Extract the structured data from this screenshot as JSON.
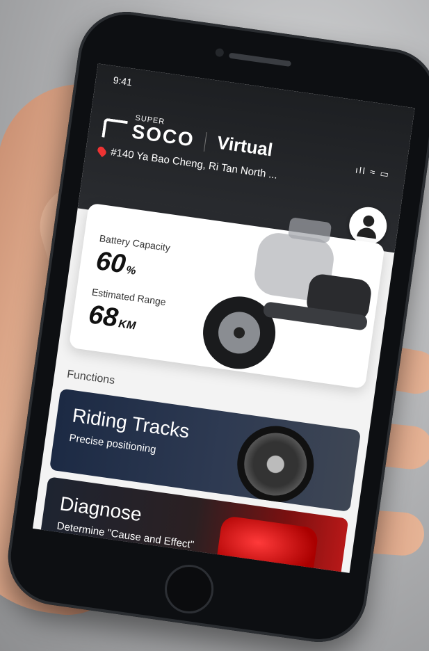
{
  "status_bar": {
    "time": "9:41",
    "icons": "ıll ≈ ▭"
  },
  "brand": {
    "super": "SUPER",
    "soco": "SOCO",
    "mode": "Virtual"
  },
  "location": "#140 Ya Bao Cheng, Ri Tan North ...",
  "vehicle": {
    "battery_label": "Battery Capacity",
    "battery_value": "60",
    "battery_unit": "%",
    "range_label": "Estimated Range",
    "range_value": "68",
    "range_unit": "KM"
  },
  "functions": {
    "title": "Functions",
    "items": [
      {
        "title": "Riding Tracks",
        "subtitle": "Precise positioning"
      },
      {
        "title": "Diagnose",
        "subtitle": "Determine \"Cause and Effect\""
      }
    ]
  },
  "colors": {
    "accent": "#e33333",
    "header_bg": "#1d1f22"
  },
  "icons": [
    "location-pin-icon",
    "avatar-icon",
    "signal-icon",
    "wifi-icon",
    "battery-icon"
  ]
}
